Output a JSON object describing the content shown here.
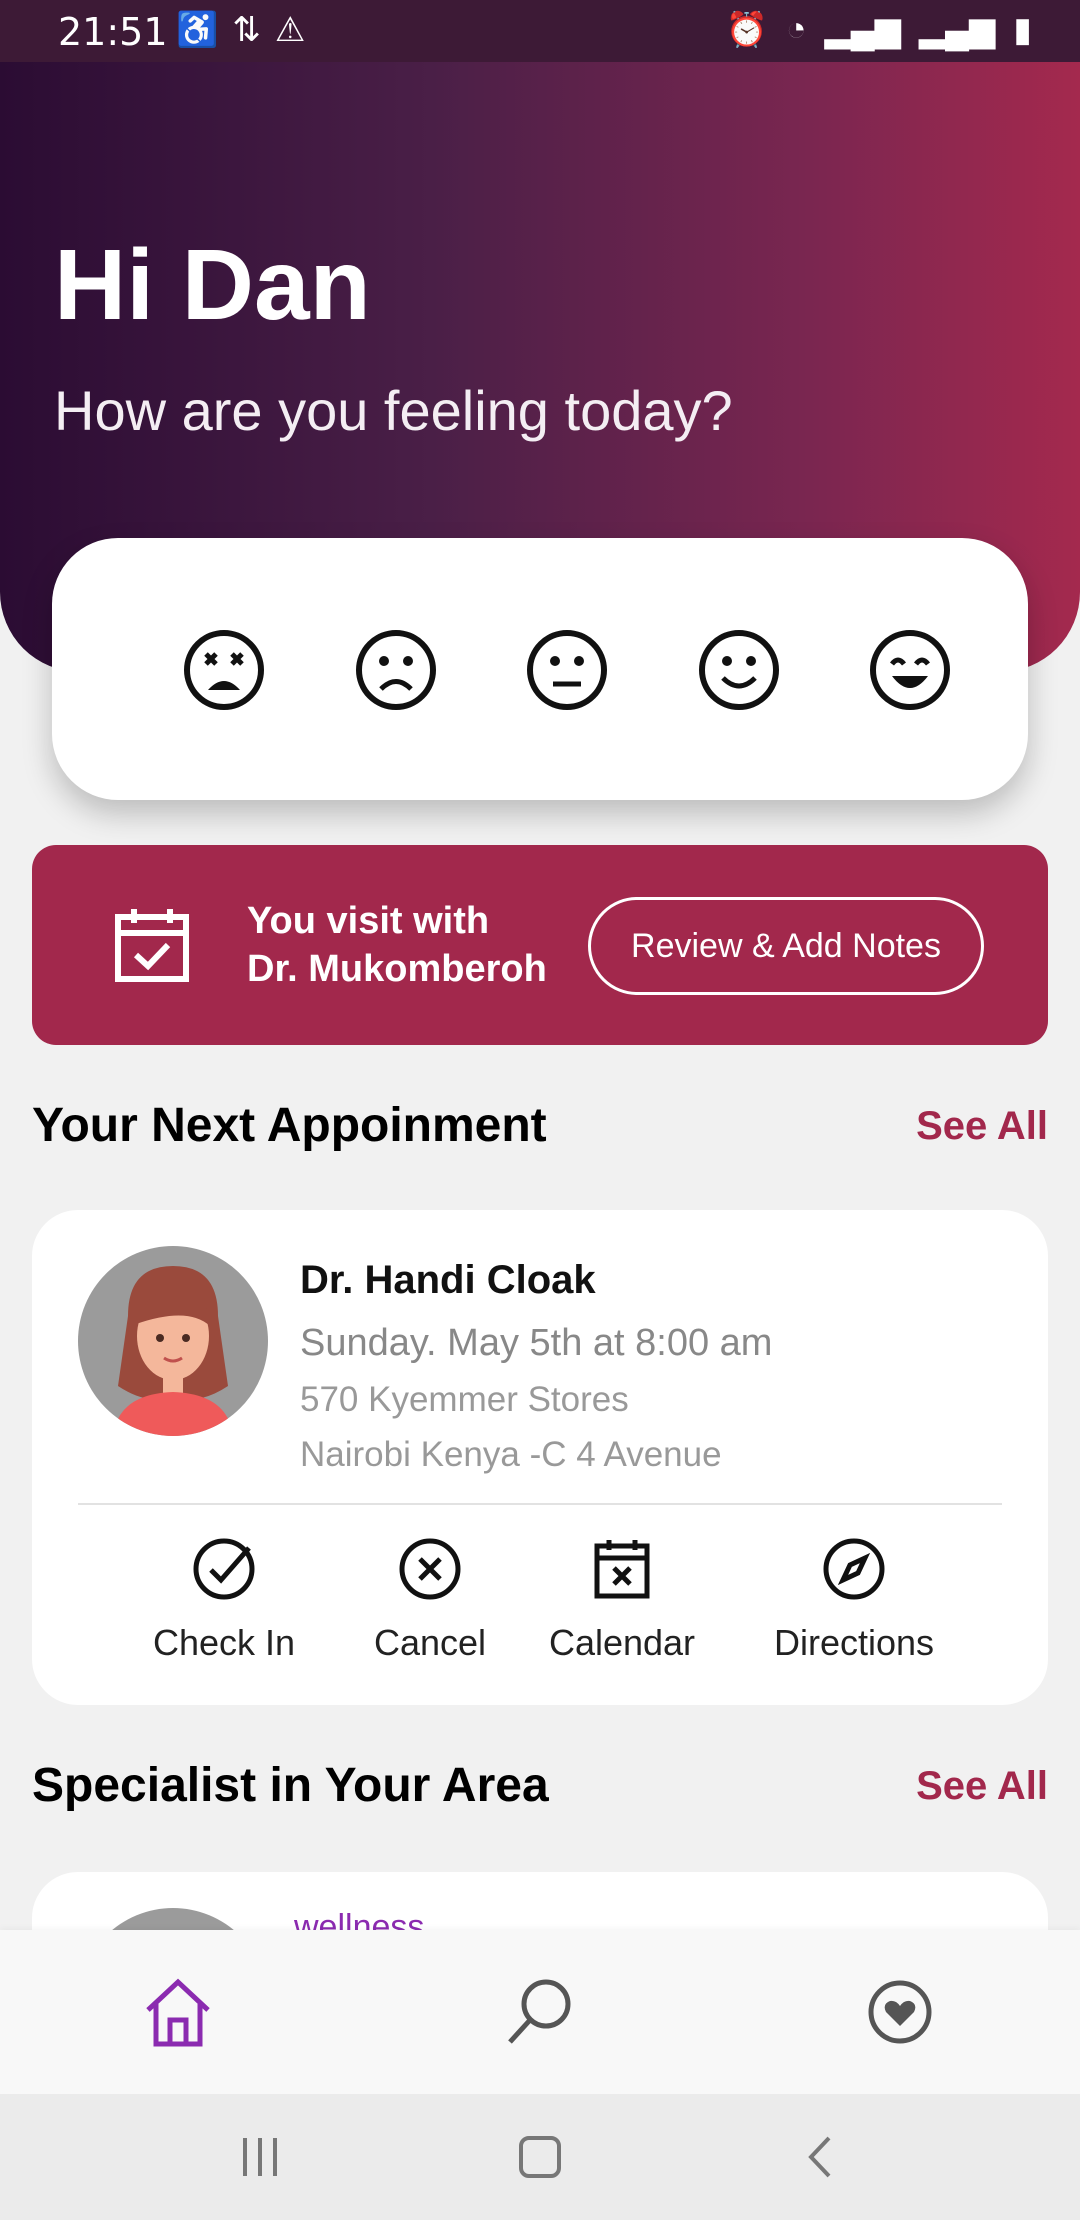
{
  "status_bar": {
    "time": "21:51",
    "left_icons": [
      "notification-icon",
      "transfer-icon",
      "warning-icon"
    ],
    "right_icons": [
      "alarm-icon",
      "wifi-icon",
      "signal-icon",
      "signal-icon",
      "battery-icon"
    ]
  },
  "header": {
    "greeting": "Hi Dan",
    "subtitle": "How are you feeling today?"
  },
  "moods": [
    "very-sad-face-icon",
    "sad-face-icon",
    "neutral-face-icon",
    "smile-face-icon",
    "very-happy-face-icon"
  ],
  "visit_banner": {
    "line1": "You visit with",
    "line2": "Dr. Mukomberoh",
    "button": "Review & Add Notes"
  },
  "appointments": {
    "title": "Your Next Appoinment",
    "see_all": "See All",
    "doctor_name": "Dr. Handi Cloak",
    "datetime": "Sunday. May 5th at 8:00 am",
    "address_line1": "570 Kyemmer Stores",
    "address_line2": "Nairobi Kenya -C 4 Avenue",
    "actions": [
      "Check In",
      "Cancel",
      "Calendar",
      "Directions"
    ]
  },
  "specialists": {
    "title": "Specialist in Your Area",
    "see_all": "See All",
    "first_label": "wellness"
  },
  "bottom_nav": [
    "home-icon",
    "search-icon",
    "favorites-icon"
  ],
  "colors": {
    "accent": "#a2284c",
    "header_start": "#2b0c33",
    "header_end": "#a4294e",
    "nav_active": "#8b2bb0"
  }
}
